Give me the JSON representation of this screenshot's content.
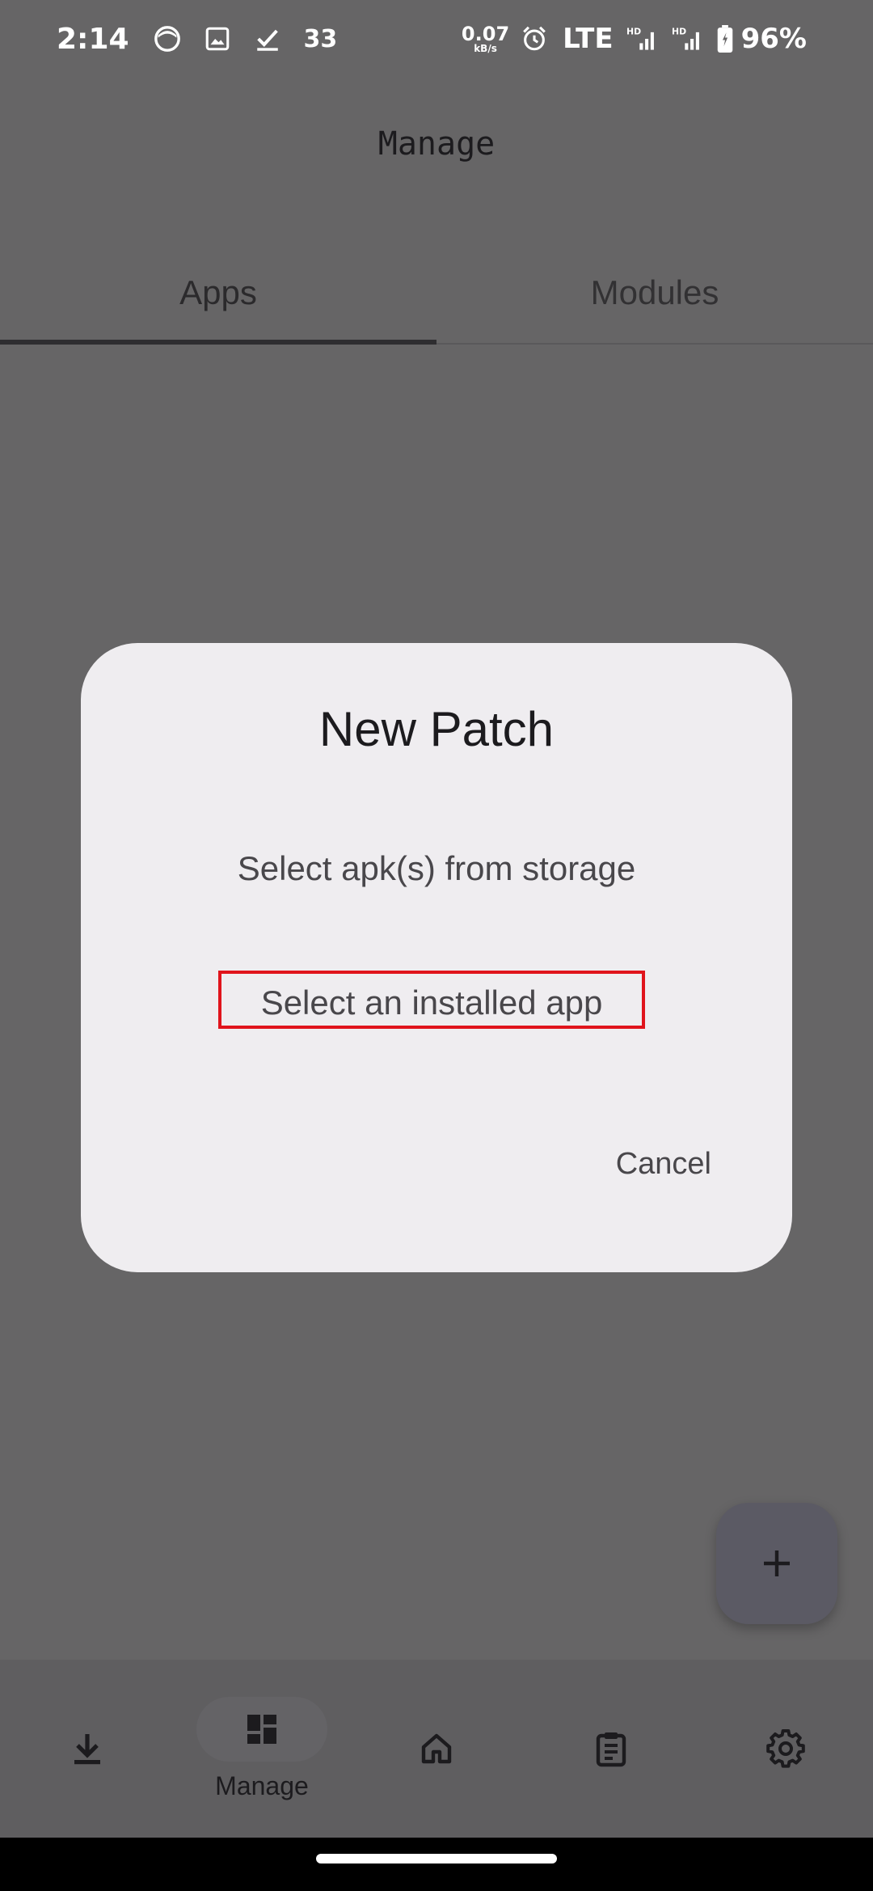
{
  "status_bar": {
    "time": "2:14",
    "notification_count": "33",
    "net_speed_value": "0.07",
    "net_speed_unit": "kB/s",
    "network_type": "LTE",
    "signal_tag": "HD",
    "battery_percent": "96%",
    "icons": [
      "face-icon",
      "image-icon",
      "check-icon",
      "alarm-icon",
      "signal-icon",
      "battery-icon"
    ]
  },
  "header": {
    "title": "Manage"
  },
  "tabs": [
    {
      "label": "Apps",
      "active": true
    },
    {
      "label": "Modules",
      "active": false
    }
  ],
  "dialog": {
    "title": "New Patch",
    "options": [
      {
        "label": "Select apk(s) from storage"
      },
      {
        "label": "Select an installed app",
        "highlighted": true
      }
    ],
    "cancel_label": "Cancel"
  },
  "fab": {
    "icon": "plus-icon"
  },
  "bottom_nav": {
    "items": [
      {
        "icon": "download-icon",
        "label": ""
      },
      {
        "icon": "dashboard-icon",
        "label": "Manage",
        "active": true
      },
      {
        "icon": "home-icon",
        "label": ""
      },
      {
        "icon": "clipboard-icon",
        "label": ""
      },
      {
        "icon": "gear-icon",
        "label": ""
      }
    ]
  },
  "colors": {
    "scrim_background": "#666566",
    "dialog_surface": "#efedf0",
    "highlight_border": "#e0141c",
    "fab_background": "#5b5a64",
    "nav_background": "#5f5e60"
  }
}
